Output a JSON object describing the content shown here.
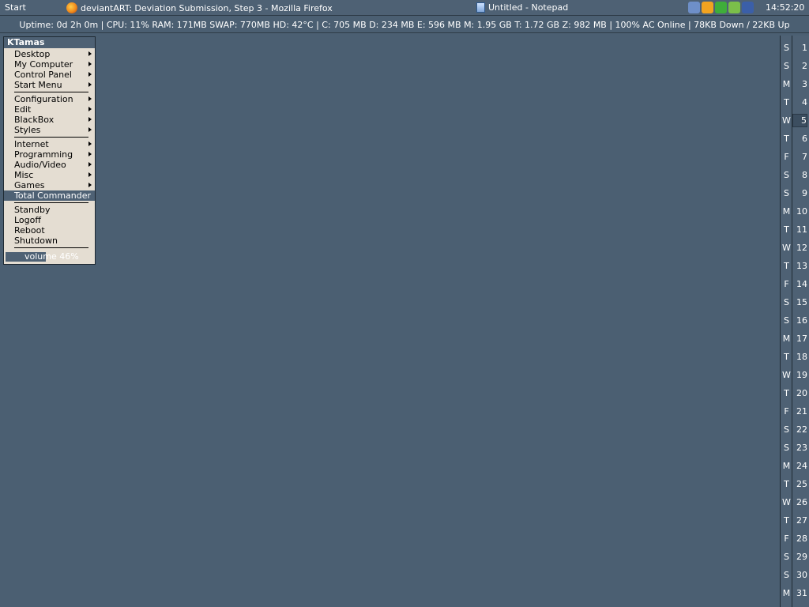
{
  "taskbar": {
    "start_label": "Start",
    "tasks": [
      {
        "title": "deviantART: Deviation Submission, Step 3 - Mozilla Firefox",
        "icon": "firefox-icon"
      },
      {
        "title": "Untitled - Notepad",
        "icon": "notepad-icon"
      }
    ],
    "tray_icons": [
      {
        "name": "shield-icon",
        "color": "#6e8fc8"
      },
      {
        "name": "clock-icon",
        "color": "#f2a320"
      },
      {
        "name": "check-icon",
        "color": "#3fae3a"
      },
      {
        "name": "user-icon",
        "color": "#7bbf4a"
      },
      {
        "name": "speaker-icon",
        "color": "#3b5fa8"
      }
    ],
    "clock": "14:52:20"
  },
  "status_bar": {
    "text": "Uptime: 0d 2h 0m | CPU: 11% RAM: 171MB SWAP: 770MB HD: 42°C | C: 705 MB D: 234 MB E: 596 MB M: 1.95 GB T: 1.72 GB Z: 982 MB | 100% AC Online | 78KB Down / 22KB Up"
  },
  "menu": {
    "title": "KTamas",
    "groups": [
      [
        {
          "label": "Desktop",
          "submenu": true
        },
        {
          "label": "My Computer",
          "submenu": true
        },
        {
          "label": "Control Panel",
          "submenu": true
        },
        {
          "label": "Start Menu",
          "submenu": true
        }
      ],
      [
        {
          "label": "Configuration",
          "submenu": true
        },
        {
          "label": "Edit",
          "submenu": true
        },
        {
          "label": "BlackBox",
          "submenu": true
        },
        {
          "label": "Styles",
          "submenu": true
        }
      ],
      [
        {
          "label": "Internet",
          "submenu": true
        },
        {
          "label": "Programming",
          "submenu": true
        },
        {
          "label": "Audio/Video",
          "submenu": true
        },
        {
          "label": "Misc",
          "submenu": true
        },
        {
          "label": "Games",
          "submenu": true
        },
        {
          "label": "Total Commander",
          "submenu": false,
          "selected": true
        }
      ],
      [
        {
          "label": "Standby",
          "submenu": false
        },
        {
          "label": "Logoff",
          "submenu": false
        },
        {
          "label": "Reboot",
          "submenu": false
        },
        {
          "label": "Shutdown",
          "submenu": false
        }
      ]
    ],
    "volume": {
      "label": "volume 46%",
      "percent": 46
    }
  },
  "calendar": {
    "today": 5,
    "days": [
      {
        "dow": "S",
        "day": "1"
      },
      {
        "dow": "S",
        "day": "2"
      },
      {
        "dow": "M",
        "day": "3"
      },
      {
        "dow": "T",
        "day": "4"
      },
      {
        "dow": "W",
        "day": "5"
      },
      {
        "dow": "T",
        "day": "6"
      },
      {
        "dow": "F",
        "day": "7"
      },
      {
        "dow": "S",
        "day": "8"
      },
      {
        "dow": "S",
        "day": "9"
      },
      {
        "dow": "M",
        "day": "10"
      },
      {
        "dow": "T",
        "day": "11"
      },
      {
        "dow": "W",
        "day": "12"
      },
      {
        "dow": "T",
        "day": "13"
      },
      {
        "dow": "F",
        "day": "14"
      },
      {
        "dow": "S",
        "day": "15"
      },
      {
        "dow": "S",
        "day": "16"
      },
      {
        "dow": "M",
        "day": "17"
      },
      {
        "dow": "T",
        "day": "18"
      },
      {
        "dow": "W",
        "day": "19"
      },
      {
        "dow": "T",
        "day": "20"
      },
      {
        "dow": "F",
        "day": "21"
      },
      {
        "dow": "S",
        "day": "22"
      },
      {
        "dow": "S",
        "day": "23"
      },
      {
        "dow": "M",
        "day": "24"
      },
      {
        "dow": "T",
        "day": "25"
      },
      {
        "dow": "W",
        "day": "26"
      },
      {
        "dow": "T",
        "day": "27"
      },
      {
        "dow": "F",
        "day": "28"
      },
      {
        "dow": "S",
        "day": "29"
      },
      {
        "dow": "S",
        "day": "30"
      },
      {
        "dow": "M",
        "day": "31"
      }
    ]
  }
}
